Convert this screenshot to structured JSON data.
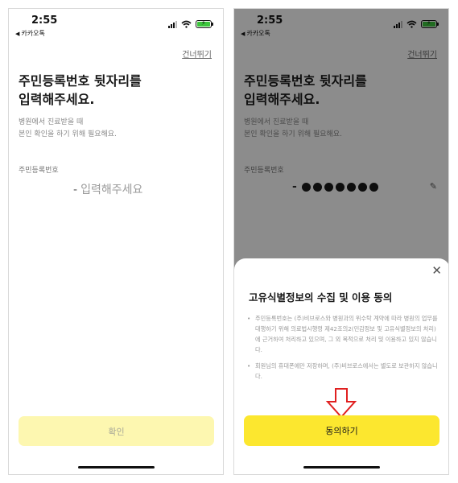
{
  "status_bar": {
    "time": "2:55",
    "back_app": "카카오톡"
  },
  "skip_label": "건너뛰기",
  "page": {
    "title_line1": "주민등록번호 뒷자리를",
    "title_line2": "입력해주세요.",
    "desc_line1": "병원에서 진료받을 때",
    "desc_line2": "본인 확인을 하기 위해 필요해요.",
    "field_label": "주민등록번호",
    "rrn_dash": "-",
    "rrn_placeholder": "입력해주세요",
    "confirm_label": "확인"
  },
  "consent_sheet": {
    "title": "고유식별정보의 수집 및 이용 동의",
    "bullet_1": "주민등록번호는 (주)비브로스와 병원과의 위수탁 계약에 따라 병원의 업무를 대행하기 위해 의료법시행령 제42조의2(민감정보 및 고유식별정보의 처리)에 근거하여 처리하고 있으며, 그 외 목적으로 처리 및 이용하고 있지 않습니다.",
    "bullet_2": "회원님의 휴대폰에만 저장하며, (주)비브로스에서는 별도로 보관하지 않습니다.",
    "agree_label": "동의하기"
  },
  "colors": {
    "kakao_yellow": "#fce72f",
    "disabled_yellow": "#fdf7b0",
    "annotation_red": "#e02020"
  },
  "icons": [
    "back-triangle-icon",
    "signal-icon",
    "wifi-icon",
    "battery-charging-icon",
    "pencil-icon",
    "close-icon",
    "down-arrow-annotation-icon"
  ]
}
